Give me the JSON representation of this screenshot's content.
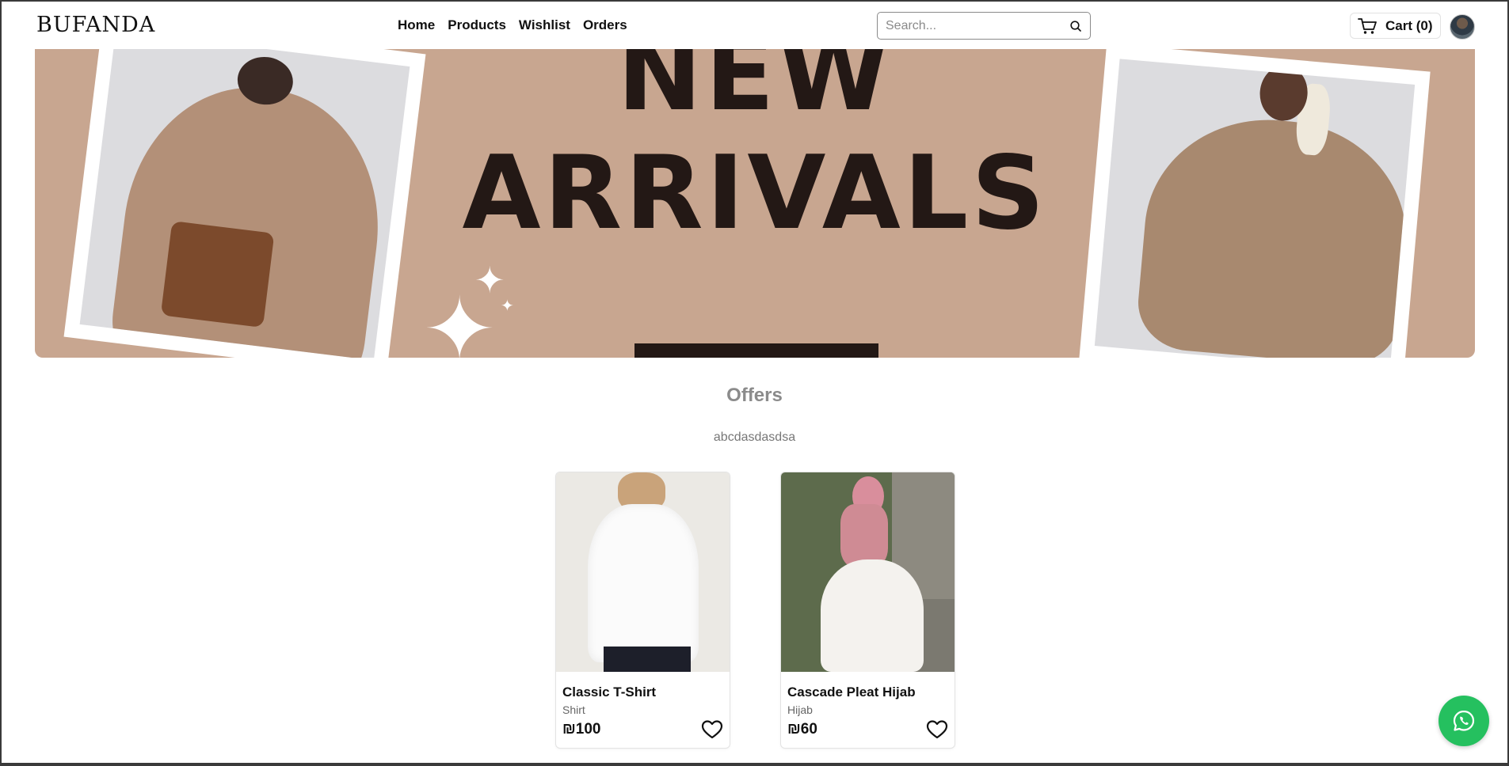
{
  "header": {
    "logo": "BUFANDA",
    "nav": [
      "Home",
      "Products",
      "Wishlist",
      "Orders"
    ],
    "search_placeholder": "Search...",
    "cart_label": "Cart (0)"
  },
  "banner": {
    "line1": "NEW",
    "line2": "ARRIVALS"
  },
  "offers": {
    "title": "Offers",
    "subtitle": "abcdasdasdsa"
  },
  "products": [
    {
      "name": "Classic T-Shirt",
      "category": "Shirt",
      "price": "₪100"
    },
    {
      "name": "Cascade Pleat Hijab",
      "category": "Hijab",
      "price": "₪60"
    }
  ],
  "colors": {
    "banner_bg": "#c8a690",
    "headline": "#231815",
    "whatsapp": "#25c05f"
  },
  "icons": [
    "search-icon",
    "cart-icon",
    "heart-icon",
    "whatsapp-icon"
  ]
}
